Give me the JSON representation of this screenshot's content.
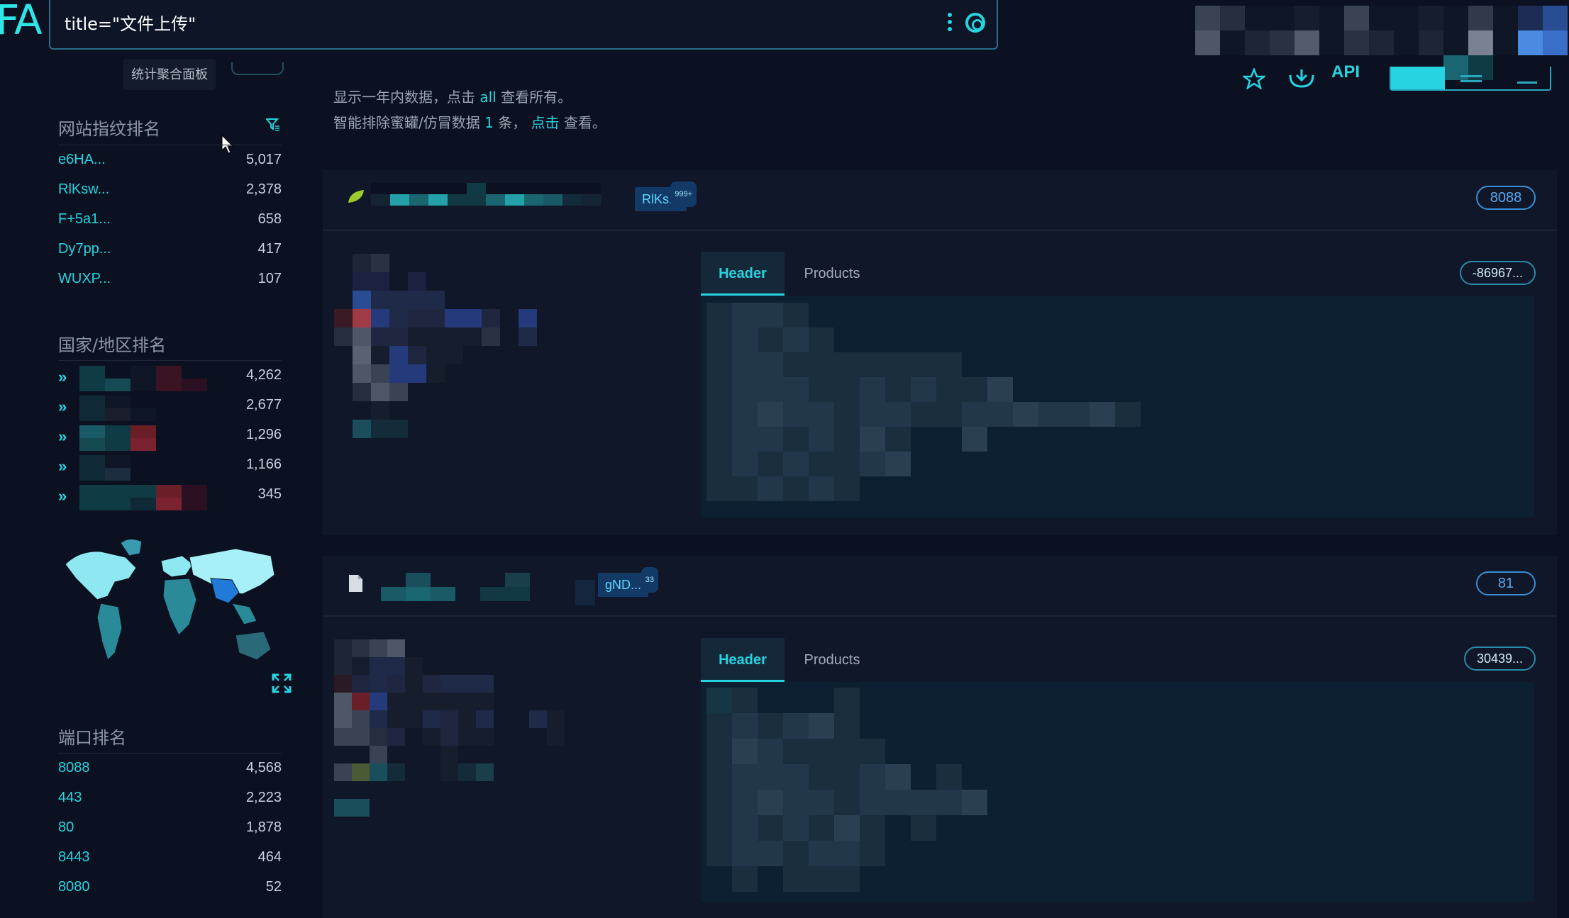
{
  "app": {
    "logo_text": "FA",
    "search_query": "title=\"文件上传\"",
    "tooltip": "统计聚合面板"
  },
  "sidebar": {
    "fingerprint": {
      "title": "网站指纹排名",
      "items": [
        {
          "name": "e6HA...",
          "count": "5,017"
        },
        {
          "name": "RlKsw...",
          "count": "2,378"
        },
        {
          "name": "F+5a1...",
          "count": "658"
        },
        {
          "name": "Dy7pp...",
          "count": "417"
        },
        {
          "name": "WUXP...",
          "count": "107"
        }
      ]
    },
    "country": {
      "title": "国家/地区排名",
      "items": [
        {
          "count": "4,262"
        },
        {
          "count": "2,677"
        },
        {
          "count": "1,296"
        },
        {
          "count": "1,166"
        },
        {
          "count": "345"
        }
      ]
    },
    "port": {
      "title": "端口排名",
      "items": [
        {
          "name": "8088",
          "count": "4,568"
        },
        {
          "name": "443",
          "count": "2,223"
        },
        {
          "name": "80",
          "count": "1,878"
        },
        {
          "name": "8443",
          "count": "464"
        },
        {
          "name": "8080",
          "count": "52"
        }
      ]
    }
  },
  "main": {
    "info_line2_a": "显示一年内数据，点击",
    "info_line2_link": "all",
    "info_line2_b": "查看所有。",
    "info_line3_a": "智能排除蜜罐/仿冒数据",
    "info_line3_num": "1",
    "info_line3_b": "条，",
    "info_line3_link": "点击",
    "info_line3_c": "查看。",
    "api_label": "API"
  },
  "results": [
    {
      "tag": "RlKs...",
      "tag_count": "999+",
      "port": "8088",
      "tab_header": "Header",
      "tab_products": "Products",
      "hash": "-86967..."
    },
    {
      "tag": "gND...",
      "tag_count": "33",
      "port": "81",
      "tab_header": "Header",
      "tab_products": "Products",
      "hash": "30439..."
    }
  ],
  "colors": {
    "background": "#0b1120",
    "accent": "#27d3e0",
    "card": "#0f1728",
    "highlight_yellow": "#e8e23a"
  }
}
